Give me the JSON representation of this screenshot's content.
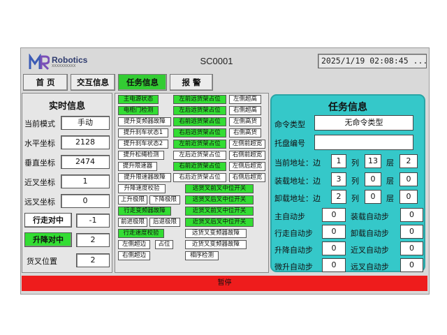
{
  "header": {
    "logo_name": "Robotics",
    "logo_sub": "XXXXXXXXXX",
    "station": "SC0001",
    "datetime": "2025/1/19 02:08:45 ..."
  },
  "tabs": [
    {
      "label": "首 页",
      "active": false
    },
    {
      "label": "交互信息",
      "active": false
    },
    {
      "label": "任务信息",
      "active": true
    },
    {
      "label": "报 警",
      "active": false
    }
  ],
  "realtime": {
    "title": "实时信息",
    "rows": [
      {
        "label": "当前模式",
        "value": "手动"
      },
      {
        "label": "水平坐标",
        "value": "2128"
      },
      {
        "label": "垂直坐标",
        "value": "2474"
      },
      {
        "label": "近叉坐标",
        "value": "1"
      },
      {
        "label": "远叉坐标",
        "value": "0"
      }
    ],
    "buttons": [
      {
        "label": "行走对中",
        "value": "-1",
        "color": "#ffffff"
      },
      {
        "label": "升降对中",
        "value": "2",
        "color": "#33dd33"
      }
    ],
    "fork": {
      "label": "货叉位置",
      "value": "2"
    }
  },
  "indicators": [
    {
      "label": "主电源状态",
      "on": true
    },
    {
      "label": "左前远货架占位",
      "on": true
    },
    {
      "label": "左侧超高",
      "on": false
    },
    {
      "label": "电柜门检测",
      "on": true
    },
    {
      "label": "左后远货架占位",
      "on": true
    },
    {
      "label": "右侧超高",
      "on": false
    },
    {
      "label": "提升变频器故障",
      "on": false
    },
    {
      "label": "右前远货架占位",
      "on": true
    },
    {
      "label": "左侧高货",
      "on": false
    },
    {
      "label": "提升刹车状态1",
      "on": false
    },
    {
      "label": "右后远货架占位",
      "on": true
    },
    {
      "label": "右侧高货",
      "on": false
    },
    {
      "label": "提升刹车状态2",
      "on": false
    },
    {
      "label": "左前近货架占位",
      "on": true
    },
    {
      "label": "左侧前超宽",
      "on": false
    },
    {
      "label": "提升松绳检测",
      "on": false
    },
    {
      "label": "左后近货架占位",
      "on": false
    },
    {
      "label": "右侧前超宽",
      "on": false
    },
    {
      "label": "提升限速器",
      "on": false
    },
    {
      "label": "右前近货架占位",
      "on": true
    },
    {
      "label": "左侧后超宽",
      "on": false
    },
    {
      "label": "提升限速器故障",
      "on": false
    },
    {
      "label": "右后近货架占位",
      "on": false
    },
    {
      "label": "右侧后超宽",
      "on": false
    },
    {
      "label": "升降速度校验",
      "on": false
    },
    {
      "label": "远货叉前叉中位开关",
      "on": true
    },
    {
      "label": "上升极限",
      "on": false
    },
    {
      "label": "下降极限",
      "on": false
    },
    {
      "label": "远货叉后叉中位开关",
      "on": true
    },
    {
      "label": "行走变频器故障",
      "on": true
    },
    {
      "label": "近货叉前叉中位开关",
      "on": true
    },
    {
      "label": "前进极限",
      "on": false
    },
    {
      "label": "后退极限",
      "on": false
    },
    {
      "label": "近货叉后叉中位开关",
      "on": true
    },
    {
      "label": "行走速度校验",
      "on": true
    },
    {
      "label": "远货叉变频器故障",
      "on": false
    },
    {
      "label": "左侧超边",
      "on": false
    },
    {
      "label": "占位",
      "on": false
    },
    {
      "label": "近货叉变频器故障",
      "on": false
    },
    {
      "label": "右侧超边",
      "on": false
    },
    {
      "label": "相序检测",
      "on": false
    }
  ],
  "task": {
    "title": "任务信息",
    "cmd_label": "命令类型",
    "cmd_value": "无命令类型",
    "pallet_label": "托盘编号",
    "pallet_value": "",
    "addresses": [
      {
        "label": "当前地址：边",
        "side": "1",
        "col_label": "列",
        "col": "13",
        "layer_label": "层",
        "layer": "2"
      },
      {
        "label": "装载地址：边",
        "side": "3",
        "col_label": "列",
        "col": "0",
        "layer_label": "层",
        "layer": "0"
      },
      {
        "label": "卸载地址：边",
        "side": "2",
        "col_label": "列",
        "col": "0",
        "layer_label": "层",
        "layer": "0"
      }
    ],
    "steps": [
      {
        "label": "主自动步",
        "value": "0",
        "label2": "装载自动步",
        "value2": "0"
      },
      {
        "label": "行走自动步",
        "value": "0",
        "label2": "卸载自动步",
        "value2": "0"
      },
      {
        "label": "升降自动步",
        "value": "0",
        "label2": "近叉自动步",
        "value2": "0"
      },
      {
        "label": "微升自动步",
        "value": "0",
        "label2": "远叉自动步",
        "value2": "0"
      }
    ]
  },
  "status": {
    "text": "暂停",
    "color": "#ee1c1c"
  }
}
